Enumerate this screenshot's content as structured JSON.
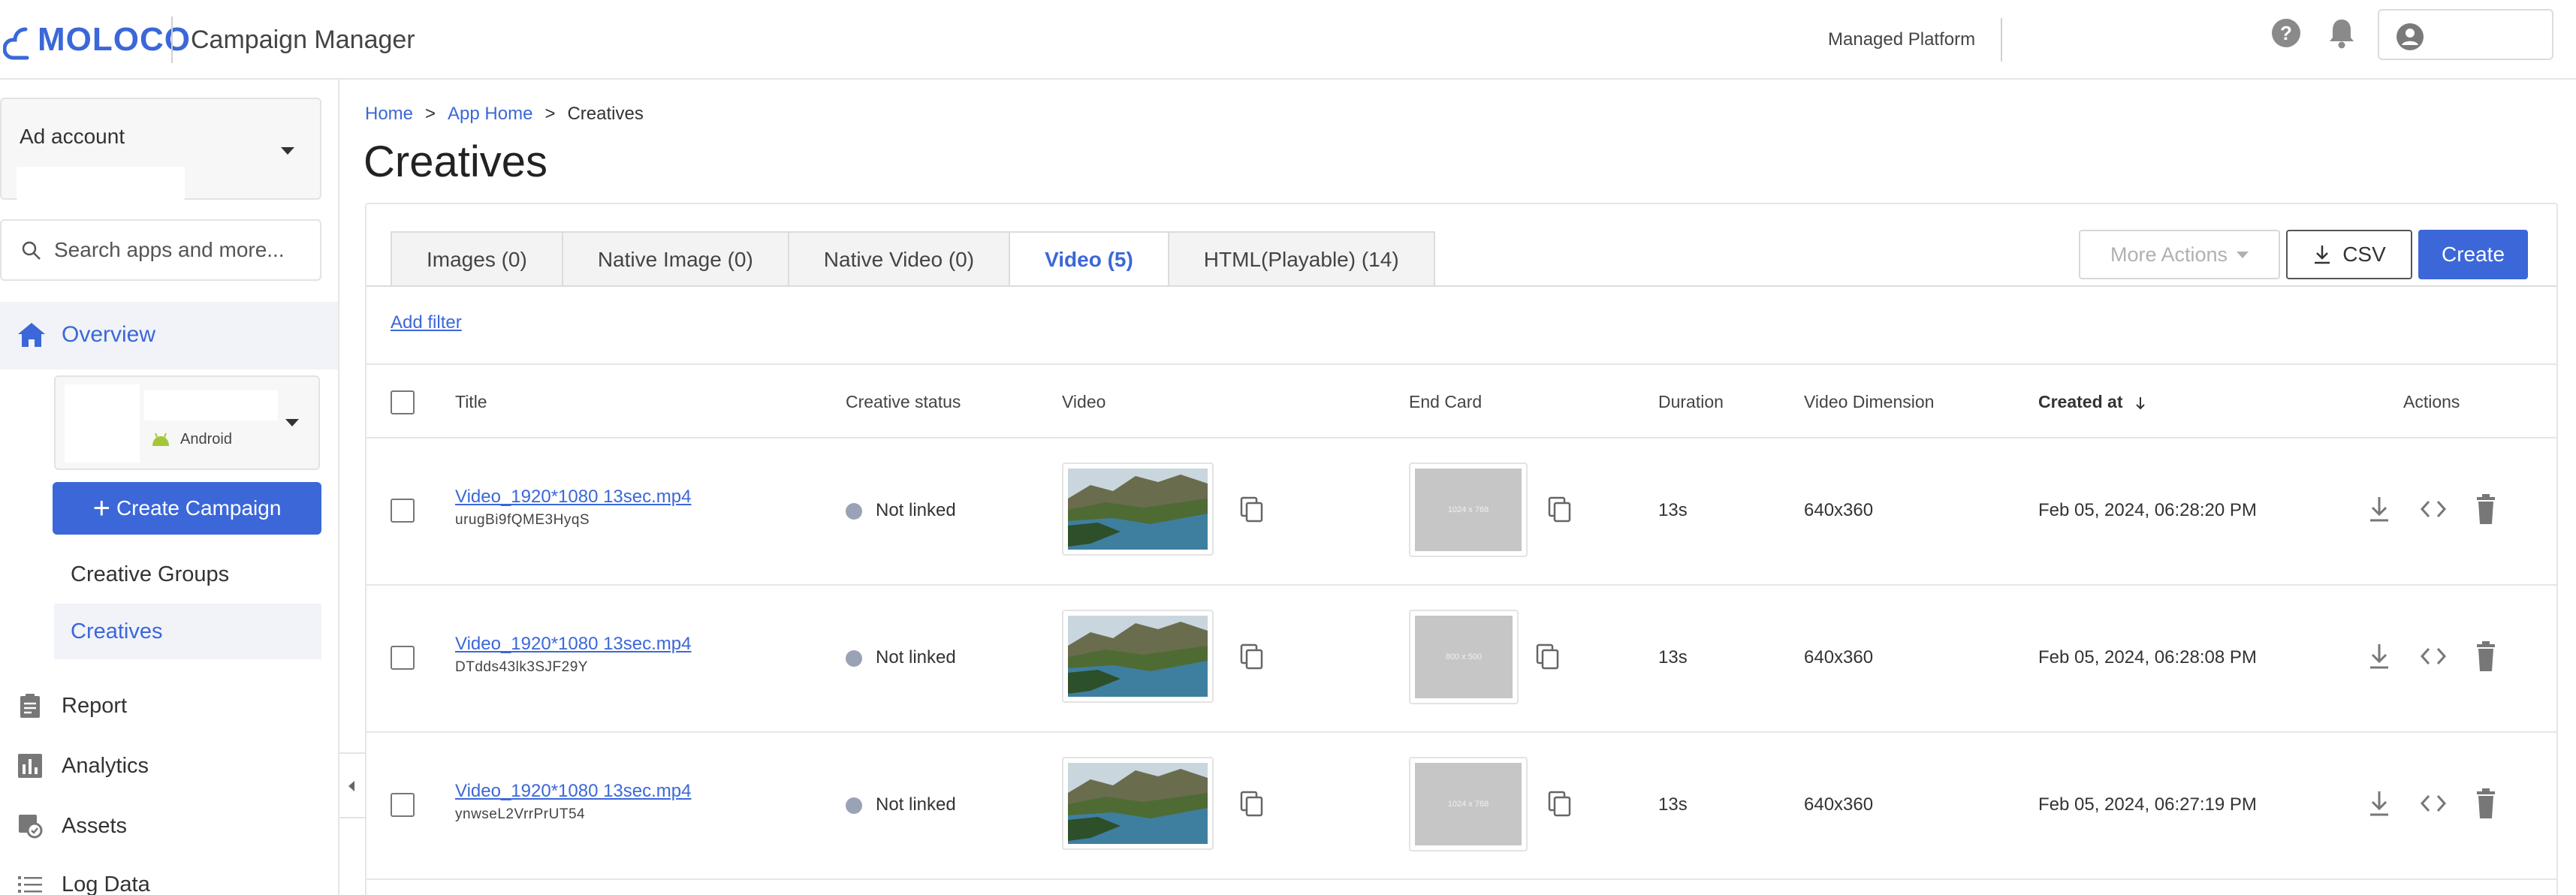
{
  "header": {
    "logo_text": "MOLOCO",
    "app_title": "Campaign Manager",
    "platform_label": "Managed Platform",
    "icons": [
      "help-icon",
      "bell-icon",
      "account-circle-icon"
    ]
  },
  "sidebar": {
    "ad_account_label": "Ad account",
    "search_placeholder": "Search apps and more...",
    "overview_label": "Overview",
    "app_platform": "Android",
    "create_campaign_label": "Create Campaign",
    "sub_items": [
      {
        "label": "Creative Groups",
        "active": false
      },
      {
        "label": "Creatives",
        "active": true
      }
    ],
    "items": [
      {
        "label": "Report",
        "icon": "clipboard-icon"
      },
      {
        "label": "Analytics",
        "icon": "bar-chart-icon"
      },
      {
        "label": "Assets",
        "icon": "assets-icon"
      },
      {
        "label": "Log Data",
        "icon": "list-icon"
      }
    ]
  },
  "breadcrumb": [
    {
      "label": "Home",
      "link": true
    },
    {
      "label": "App Home",
      "link": true
    },
    {
      "label": "Creatives",
      "link": false
    }
  ],
  "breadcrumb_sep": ">",
  "page_title": "Creatives",
  "tabs": [
    {
      "label": "Images (0)",
      "active": false
    },
    {
      "label": "Native Image (0)",
      "active": false
    },
    {
      "label": "Native Video (0)",
      "active": false
    },
    {
      "label": "Video (5)",
      "active": true
    },
    {
      "label": "HTML(Playable) (14)",
      "active": false
    }
  ],
  "toolbar": {
    "more_actions_label": "More Actions",
    "csv_label": "CSV",
    "create_label": "Create"
  },
  "add_filter_label": "Add filter",
  "table": {
    "columns": {
      "title": "Title",
      "status": "Creative status",
      "video": "Video",
      "end_card": "End Card",
      "duration": "Duration",
      "dimension": "Video Dimension",
      "created": "Created at",
      "actions": "Actions"
    },
    "sort_column": "created",
    "sort_direction": "descending",
    "rows": [
      {
        "title": "Video_1920*1080 13sec.mp4",
        "id": "urugBi9fQME3HyqS",
        "status": "Not linked",
        "end_card_size": "1024 x 768",
        "duration": "13s",
        "dimension": "640x360",
        "created": "Feb 05, 2024, 06:28:20 PM"
      },
      {
        "title": "Video_1920*1080 13sec.mp4",
        "id": "DTdds43lk3SJF29Y",
        "status": "Not linked",
        "end_card_size": "800 x 500",
        "duration": "13s",
        "dimension": "640x360",
        "created": "Feb 05, 2024, 06:28:08 PM"
      },
      {
        "title": "Video_1920*1080 13sec.mp4",
        "id": "ynwseL2VrrPrUT54",
        "status": "Not linked",
        "end_card_size": "1024 x 768",
        "duration": "13s",
        "dimension": "640x360",
        "created": "Feb 05, 2024, 06:27:19 PM"
      }
    ]
  },
  "colors": {
    "accent": "#3b67d9",
    "status_not_linked": "#9aa3b5",
    "border": "#e6e6e6"
  }
}
